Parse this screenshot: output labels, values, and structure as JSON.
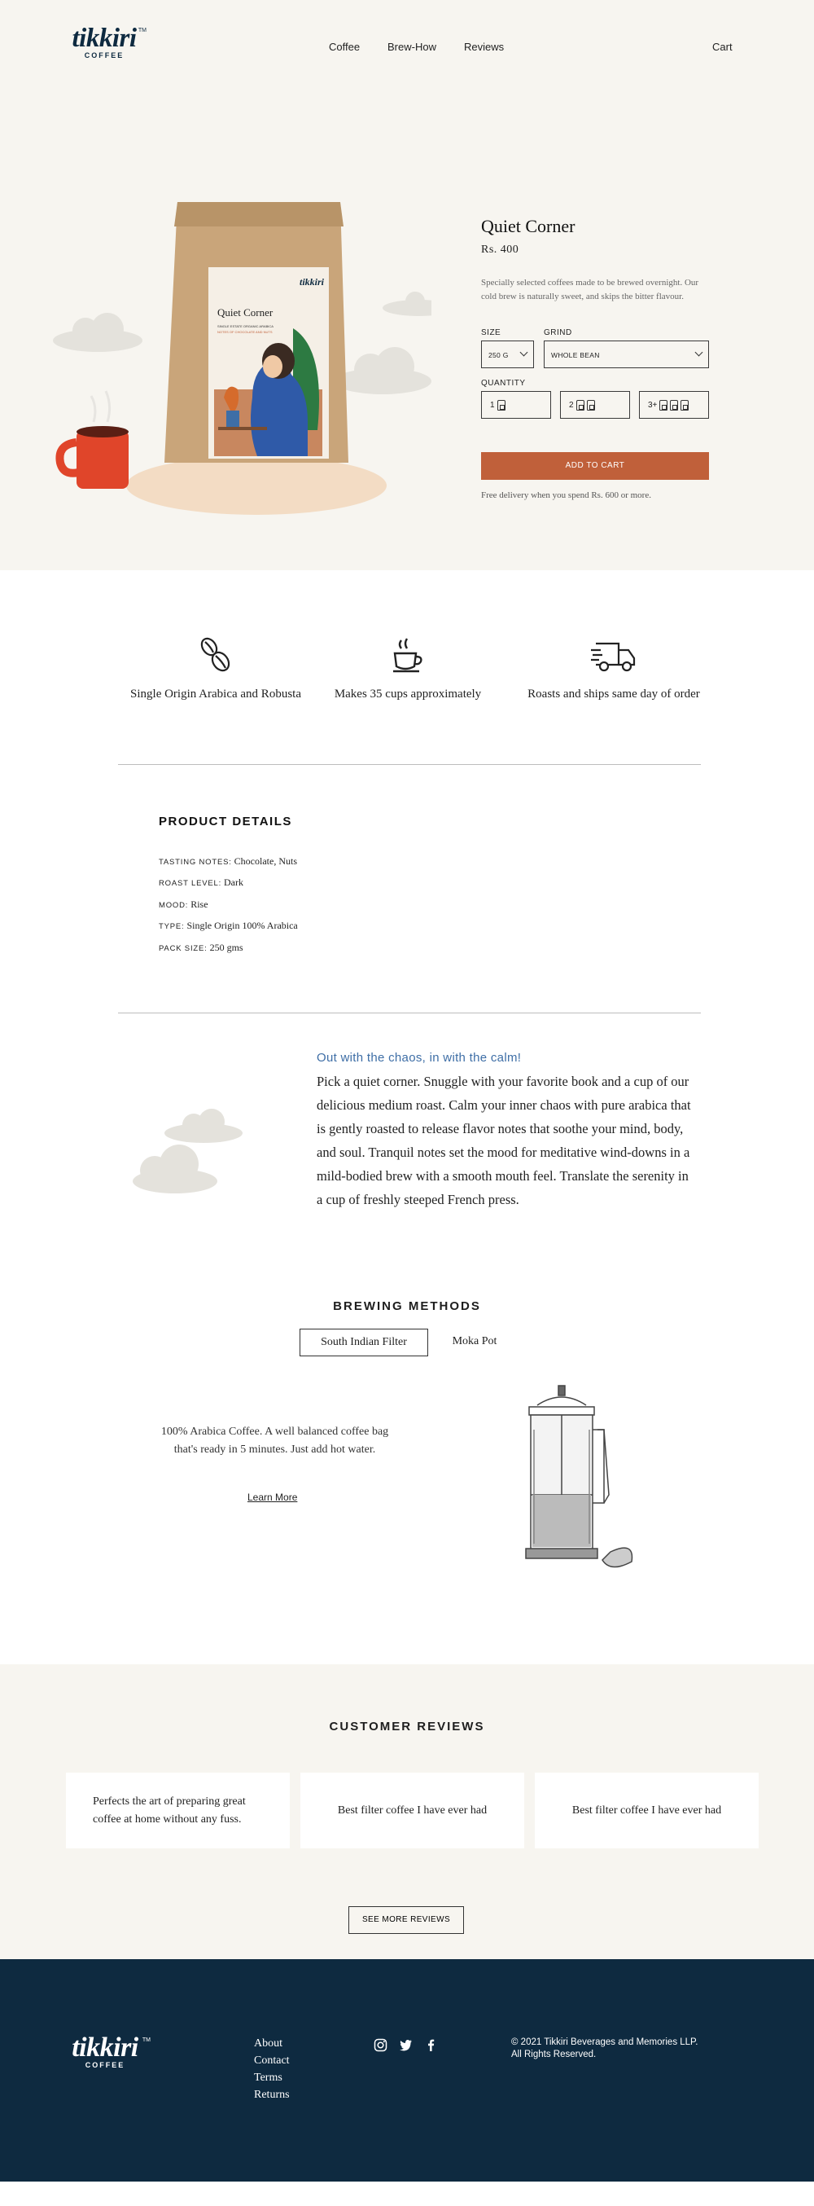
{
  "brand": {
    "name": "tikkiri",
    "sub": "COFFEE",
    "tm": "TM"
  },
  "nav": {
    "items": [
      "Coffee",
      "Brew-How",
      "Reviews"
    ],
    "cart": "Cart"
  },
  "package": {
    "name": "Quiet Corner",
    "line1": "SINGLE ESTATE ORGANIC ARABICA",
    "line2": "NOTES OF CHOCOLATE AND NUTS",
    "brand": "tikkiri"
  },
  "product": {
    "title": "Quiet Corner",
    "price": "Rs. 400",
    "description": "Specially selected coffees made to be brewed overnight. Our cold brew is naturally sweet, and skips the bitter flavour.",
    "size_label": "SIZE",
    "size_value": "250 G",
    "grind_label": "GRIND",
    "grind_value": "WHOLE BEAN",
    "quantity_label": "QUANTITY",
    "quantity_options": [
      "1",
      "2",
      "3+"
    ],
    "add_to_cart": "ADD TO CART",
    "delivery_note": "Free delivery when you spend Rs. 600 or more."
  },
  "features": [
    {
      "icon": "coffee-beans-icon",
      "text": "Single Origin Arabica and Robusta"
    },
    {
      "icon": "coffee-cup-icon",
      "text": "Makes 35 cups approximately"
    },
    {
      "icon": "delivery-truck-icon",
      "text": "Roasts and ships same day of order"
    }
  ],
  "details": {
    "title": "PRODUCT DETAILS",
    "rows": [
      {
        "key": "TASTING NOTES:",
        "value": "Chocolate, Nuts"
      },
      {
        "key": "ROAST LEVEL:",
        "value": "Dark"
      },
      {
        "key": "MOOD:",
        "value": "Rise"
      },
      {
        "key": "TYPE:",
        "value": "Single Origin 100% Arabica"
      },
      {
        "key": "PACK SIZE:",
        "value": "250 gms"
      }
    ]
  },
  "story": {
    "heading": "Out with the chaos, in with the calm!",
    "body": "Pick a quiet corner. Snuggle with your favorite book and a cup of our delicious medium roast. Calm your inner chaos with pure arabica that is gently roasted to release flavor notes that soothe your mind, body, and soul. Tranquil notes set the mood for meditative wind-downs in a mild-bodied brew with a smooth mouth feel. Translate the serenity in a cup of freshly steeped French press."
  },
  "brewing": {
    "title": "BREWING  METHODS",
    "tabs": [
      "South Indian Filter",
      "Moka Pot"
    ],
    "description": "100% Arabica Coffee. A well balanced coffee bag that's ready in 5 minutes. Just add hot water.",
    "learn_more": "Learn More"
  },
  "reviews": {
    "title": "CUSTOMER REVIEWS",
    "items": [
      "Perfects the art of preparing great coffee at home without any fuss.",
      "Best filter coffee I have ever had",
      "Best filter coffee I have ever had"
    ],
    "see_more": "SEE MORE REVIEWS"
  },
  "footer": {
    "links": [
      "About",
      "Contact",
      "Terms",
      "Returns"
    ],
    "social": [
      "instagram-icon",
      "twitter-icon",
      "facebook-icon"
    ],
    "copyright_line1": "© 2021 Tikkiri Beverages and Memories LLP.",
    "copyright_line2": "All Rights Reserved."
  },
  "colors": {
    "accent": "#c0603a",
    "navy": "#0e2a40",
    "cream": "#f7f5f0",
    "story_heading": "#3e6ea6"
  }
}
